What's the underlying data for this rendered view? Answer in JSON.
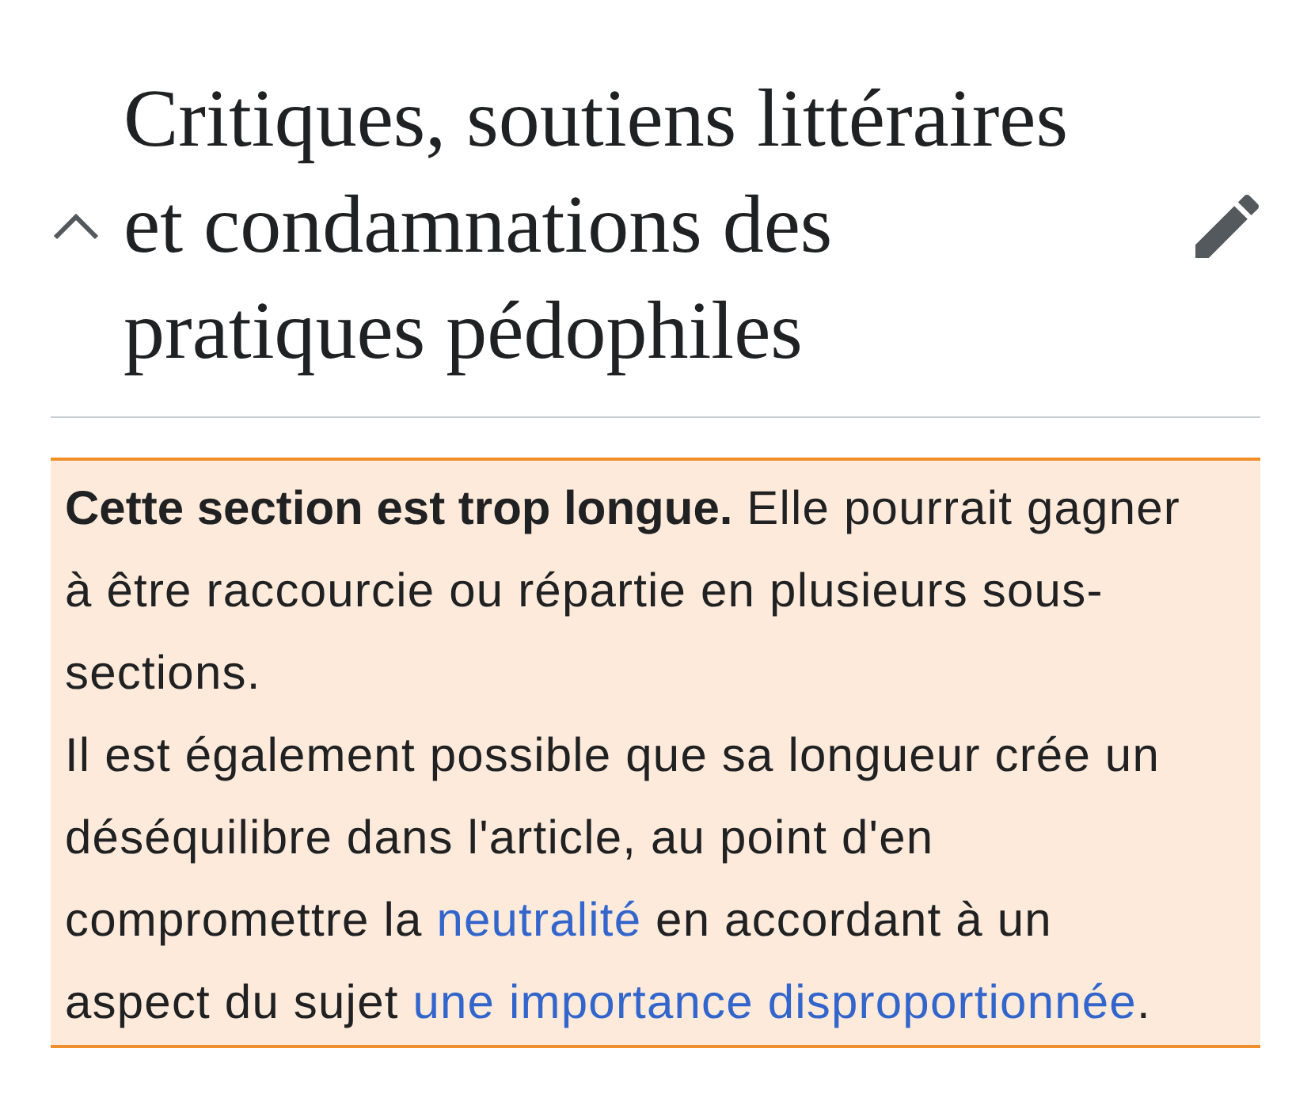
{
  "section": {
    "title": "Critiques, soutiens littéraires et condamnations des pratiques pédophiles",
    "expanded": true
  },
  "notice": {
    "paragraphs": [
      {
        "parts": [
          {
            "kind": "text",
            "text": "**Cette section est trop longue.** Elle pourrait gagner à être raccourcie ou répartie en plusieurs sous-sections."
          }
        ]
      },
      {
        "parts": [
          {
            "kind": "text",
            "text": "Il est également possible que sa longueur crée un déséquilibre dans l'article, au point d'en compromettre la "
          },
          {
            "kind": "link",
            "text": "neutralité"
          },
          {
            "kind": "text",
            "text": " en accordant à un aspect du sujet "
          },
          {
            "kind": "link",
            "text": "une importance disproportionnée"
          },
          {
            "kind": "text",
            "text": "."
          }
        ]
      }
    ]
  }
}
